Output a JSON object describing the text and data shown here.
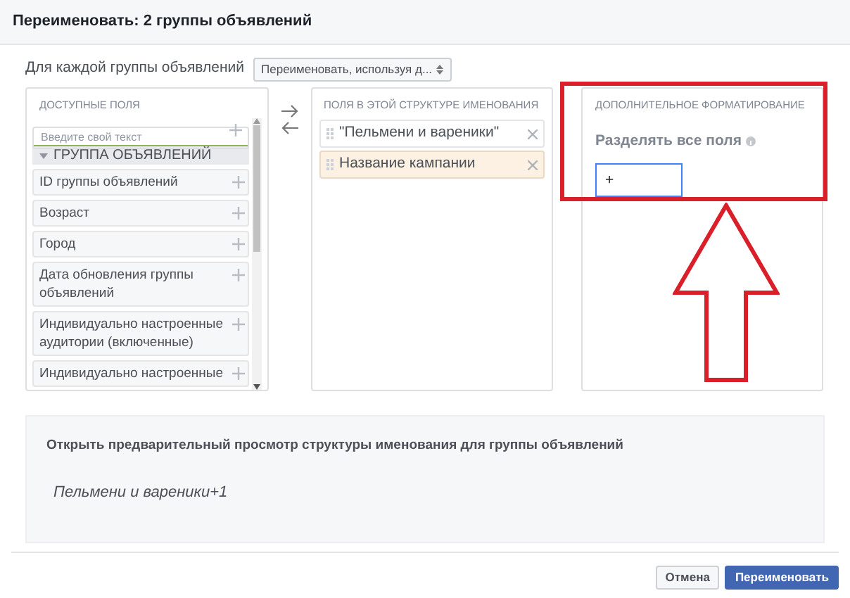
{
  "dialog": {
    "title": "Переименовать: 2 группы объявлений"
  },
  "naming_mode": {
    "label": "Для каждой группы объявлений",
    "value": "Переименовать, используя д..."
  },
  "available_fields": {
    "heading": "ДОСТУПНЫЕ ПОЛЯ",
    "search": {
      "placeholder": "Введите свой текст"
    },
    "group": {
      "label": "ГРУППА ОБЪЯВЛЕНИЙ",
      "expanded": true
    },
    "items": [
      "ID группы объявлений",
      "Возраст",
      "Город",
      "Дата обновления группы объявлений",
      "Индивидуально настроенные аудитории (включенные)",
      "Индивидуально настроенные"
    ]
  },
  "structure_fields": {
    "heading": "ПОЛЯ В ЭТОЙ СТРУКТУРЕ ИМЕНОВАНИЯ",
    "items": [
      {
        "text": "\"Пельмени и вареники\"",
        "selected": false
      },
      {
        "text": "Название кампании",
        "selected": true
      }
    ]
  },
  "formatting": {
    "heading": "ДОПОЛНИТЕЛЬНОЕ ФОРМАТИРОВАНИЕ",
    "separator": {
      "label": "Разделять все поля",
      "value": "+"
    }
  },
  "preview": {
    "title": "Открыть предварительный просмотр структуры именования для группы объявлений",
    "text": "Пельмени и вареники+1"
  },
  "buttons": [
    {
      "label": "Отмена",
      "kind": "secondary"
    },
    {
      "label": "Переименовать",
      "kind": "primary"
    }
  ]
}
